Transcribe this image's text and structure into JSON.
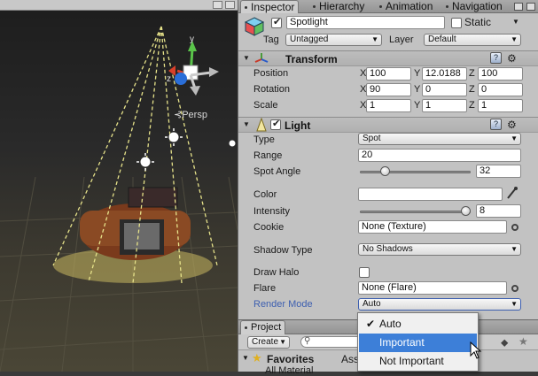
{
  "scene": {
    "persp_label": "Persp",
    "gizmo_axis_y": "y",
    "gizmo_axis_z": "z"
  },
  "inspector": {
    "tabs": [
      "Inspector",
      "Hierarchy",
      "Animation",
      "Navigation"
    ],
    "object": {
      "active": true,
      "name": "Spotlight",
      "static_label": "Static",
      "static_checked": false,
      "tag_label": "Tag",
      "tag_value": "Untagged",
      "layer_label": "Layer",
      "layer_value": "Default"
    },
    "transform": {
      "title": "Transform",
      "rows": [
        {
          "label": "Position",
          "x": "100",
          "y": "12.0188",
          "z": "100"
        },
        {
          "label": "Rotation",
          "x": "90",
          "y": "0",
          "z": "0"
        },
        {
          "label": "Scale",
          "x": "1",
          "y": "1",
          "z": "1"
        }
      ],
      "axis_labels": [
        "X",
        "Y",
        "Z"
      ]
    },
    "light": {
      "title": "Light",
      "enabled": true,
      "type_label": "Type",
      "type_value": "Spot",
      "range_label": "Range",
      "range_value": "20",
      "spot_angle_label": "Spot Angle",
      "spot_angle_value": "32",
      "spot_angle_fraction": 0.2,
      "color_label": "Color",
      "color_value": "#ffffff",
      "intensity_label": "Intensity",
      "intensity_value": "8",
      "intensity_fraction": 1.0,
      "cookie_label": "Cookie",
      "cookie_value": "None (Texture)",
      "shadow_type_label": "Shadow Type",
      "shadow_type_value": "No Shadows",
      "draw_halo_label": "Draw Halo",
      "draw_halo_checked": false,
      "flare_label": "Flare",
      "flare_value": "None (Flare)",
      "render_mode_label": "Render Mode",
      "render_mode_value": "Auto"
    }
  },
  "project": {
    "tab": "Project",
    "create_label": "Create",
    "favorites_label": "Favorites",
    "assets_label": "Ass",
    "all_materials_label": "All Material"
  },
  "render_mode_menu": {
    "options": [
      {
        "label": "Auto",
        "checked": true,
        "highlighted": false
      },
      {
        "label": "Important",
        "checked": false,
        "highlighted": true
      },
      {
        "label": "Not Important",
        "checked": false,
        "highlighted": false
      }
    ]
  },
  "colors": {
    "highlight": "#3d7fd8",
    "render_mode_label": "#3d5fb0",
    "light_cone": "#e6e28a"
  }
}
